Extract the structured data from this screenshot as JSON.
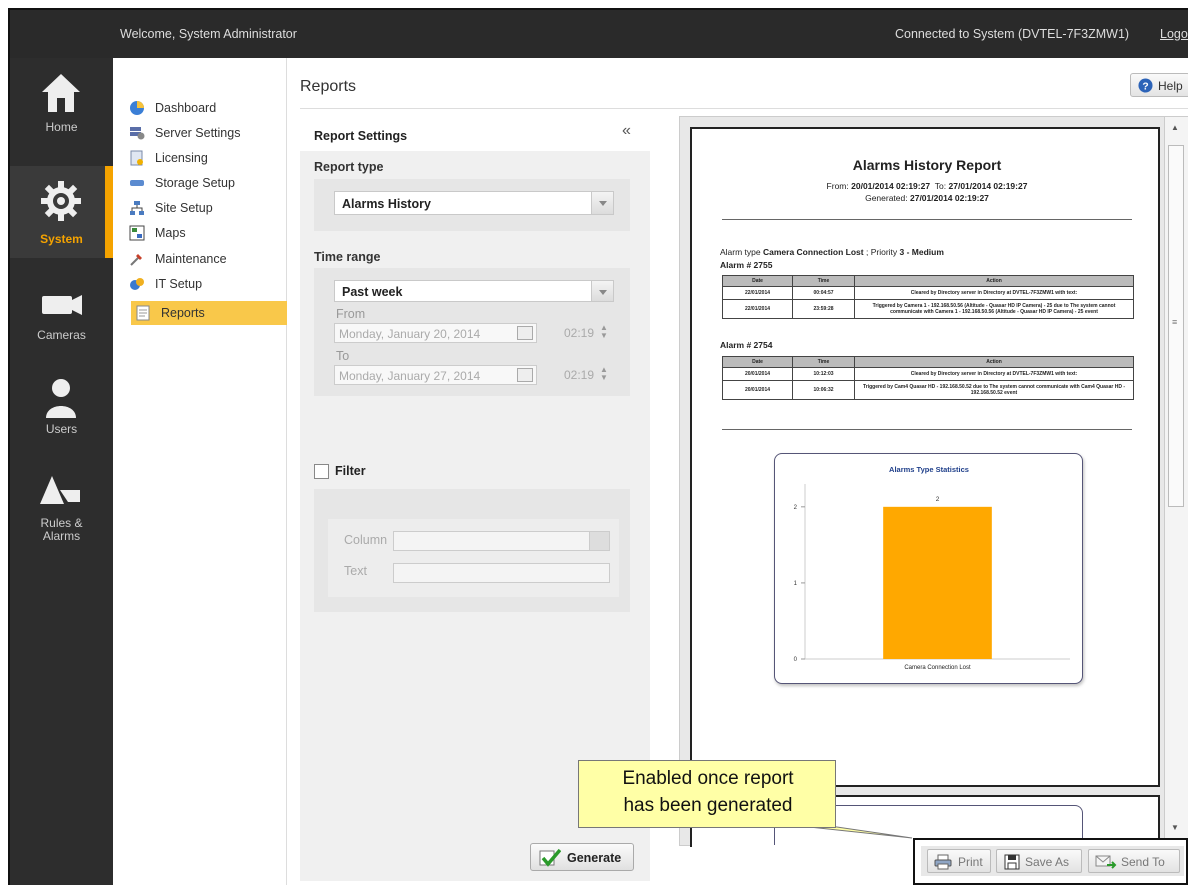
{
  "topbar": {
    "welcome": "Welcome, System Administrator",
    "connected": "Connected to System (DVTEL-7F3ZMW1)",
    "logout": "Logout"
  },
  "rail": [
    {
      "label": "Home",
      "icon": "home-icon"
    },
    {
      "label": "System",
      "icon": "gear-icon",
      "active": true
    },
    {
      "label": "Cameras",
      "icon": "camera-icon"
    },
    {
      "label": "Users",
      "icon": "user-icon"
    },
    {
      "label": "Rules &",
      "label2": "Alarms",
      "icon": "rules-alarms-icon"
    }
  ],
  "menu": [
    {
      "label": "Dashboard",
      "icon": "dashboard-icon"
    },
    {
      "label": "Server Settings",
      "icon": "server-settings-icon"
    },
    {
      "label": "Licensing",
      "icon": "licensing-icon"
    },
    {
      "label": "Storage Setup",
      "icon": "storage-icon"
    },
    {
      "label": "Site Setup",
      "icon": "site-setup-icon"
    },
    {
      "label": "Maps",
      "icon": "maps-icon"
    },
    {
      "label": "Maintenance",
      "icon": "maintenance-icon"
    },
    {
      "label": "IT Setup",
      "icon": "it-setup-icon"
    },
    {
      "label": "Reports",
      "icon": "reports-icon",
      "active": true
    }
  ],
  "page": {
    "title": "Reports",
    "help": "Help"
  },
  "settings": {
    "heading": "Report Settings",
    "collapse": "«",
    "report_type_label": "Report type",
    "report_type_value": "Alarms History",
    "time_range_label": "Time range",
    "time_range_value": "Past week",
    "from_label": "From",
    "from_date": "Monday, January 20, 2014",
    "from_time": "02:19",
    "to_label": "To",
    "to_date": "Monday, January 27, 2014",
    "to_time": "02:19",
    "filter_label": "Filter",
    "column_label": "Column",
    "text_label": "Text",
    "generate": "Generate"
  },
  "report": {
    "title": "Alarms History Report",
    "from_label": "From:",
    "from_value": "20/01/2014 02:19:27",
    "to_label": "To:",
    "to_value": "27/01/2014 02:19:27",
    "generated_label": "Generated:",
    "generated_value": "27/01/2014 02:19:27",
    "alarm_type_prefix": "Alarm type",
    "alarm_type": "Camera Connection Lost",
    "priority_prefix": "; Priority",
    "priority": "3 - Medium",
    "columns": [
      "Date",
      "Time",
      "Action"
    ],
    "alarms": [
      {
        "title": "Alarm # 2755",
        "rows": [
          [
            "22/01/2014",
            "00:04:57",
            "Cleared by Directory server in Directory at DVTEL-7F3ZMW1 with text:"
          ],
          [
            "22/01/2014",
            "23:59:28",
            "Triggered by Camera 1 - 192.168.50.56 (Altitude - Quasar HD IP Camera) - 25 due to The system cannot communicate with Camera 1 - 192.168.50.56 (Altitude - Quasar HD IP Camera) - 25 event"
          ]
        ]
      },
      {
        "title": "Alarm # 2754",
        "rows": [
          [
            "20/01/2014",
            "10:12:03",
            "Cleared by Directory server in Directory at DVTEL-7F3ZMW1 with text:"
          ],
          [
            "20/01/2014",
            "10:06:32",
            "Triggered by Cam4 Quasar HD - 192.168.50.52 due to The system cannot communicate with Cam4 Quasar HD - 192.168.50.52 event"
          ]
        ]
      }
    ]
  },
  "chart_data": {
    "type": "bar",
    "title": "Alarms Type Statistics",
    "categories": [
      "Camera Connection Lost"
    ],
    "values": [
      2
    ],
    "data_labels": [
      "2"
    ],
    "yticks": [
      "0",
      "1",
      "2"
    ],
    "ylim": [
      0,
      2.3
    ],
    "bar_color": "#ffa800",
    "legend": "none"
  },
  "actions": {
    "print": "Print",
    "save_as": "Save As",
    "send_to": "Send To"
  },
  "callout": {
    "line1": "Enabled once report",
    "line2": "has been generated"
  },
  "colors": {
    "accent": "#f5a300",
    "menu_active": "#f9c84a",
    "topbar": "#2a2a2a",
    "callout": "#ffffa6"
  }
}
